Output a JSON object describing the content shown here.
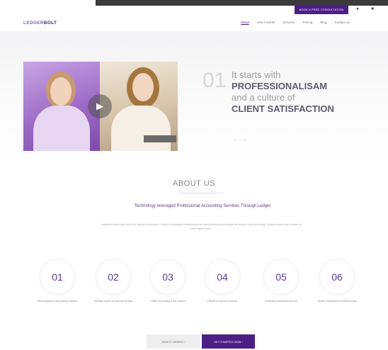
{
  "topbar": {
    "cta_label": "BOOK A FREE CONSULTATION",
    "icons": [
      "user-icon",
      "cart-icon"
    ]
  },
  "header": {
    "logo_part1": "LEDGER",
    "logo_part2": "BOLT",
    "menu": [
      {
        "label": "About",
        "active": true
      },
      {
        "label": "How it works",
        "active": false
      },
      {
        "label": "Services",
        "active": false
      },
      {
        "label": "Pricing",
        "active": false
      },
      {
        "label": "Blog",
        "active": false
      },
      {
        "label": "Contact us",
        "active": false
      }
    ]
  },
  "hero": {
    "number": "01",
    "line1": "It starts with",
    "line2": "PROFESSIONALISAM",
    "line3": "and a culture of",
    "line4": "CLIENT SATISFACTION",
    "play_icon": "play-icon",
    "dots": "• •"
  },
  "about": {
    "title": "ABOUT US",
    "subtitle": "Technology leveraged Professional Accounting Services Through Ledger",
    "body": "LedgerBolt works with small and medium businesses to deliver professional bookkeeping and accounting services backed by modern cloud technology, helping owners stay focused on what matters most."
  },
  "features": [
    {
      "num": "01",
      "caption": "Book-keeping & accounting software"
    },
    {
      "num": "02",
      "caption": "Monthly reports & financial reviews"
    },
    {
      "num": "03",
      "caption": "Online accounting & tax support"
    },
    {
      "num": "04",
      "caption": "Payroll & expense tracking"
    },
    {
      "num": "05",
      "caption": "Dedicated accountant for you"
    },
    {
      "num": "06",
      "caption": "Simple, transparent monthly pricing"
    }
  ],
  "buttons": {
    "secondary": "HOW IT WORKS ›",
    "primary": "GET STARTED NOW ›"
  },
  "colors": {
    "brand": "#4b1f86",
    "accent": "#5b3a93"
  }
}
